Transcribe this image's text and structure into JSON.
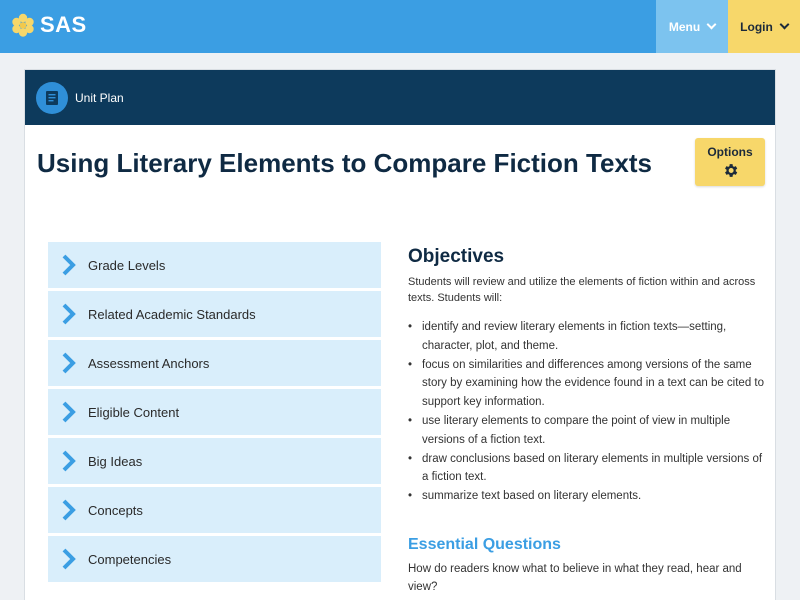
{
  "header": {
    "logo_text": "SAS",
    "menu_label": "Menu",
    "login_label": "Login",
    "colors": {
      "bar": "#3b9ee3",
      "menu": "#7cc3ef",
      "login": "#f7d76a"
    }
  },
  "unit": {
    "label": "Unit Plan",
    "icon": "document-icon"
  },
  "page": {
    "title": "Using Literary Elements to Compare Fiction Texts"
  },
  "options": {
    "label": "Options",
    "icon": "gear-icon"
  },
  "accordion": {
    "items": [
      {
        "label": "Grade Levels"
      },
      {
        "label": "Related Academic Standards"
      },
      {
        "label": "Assessment Anchors"
      },
      {
        "label": "Eligible Content"
      },
      {
        "label": "Big Ideas"
      },
      {
        "label": "Concepts"
      },
      {
        "label": "Competencies"
      }
    ]
  },
  "objectives": {
    "title": "Objectives",
    "intro": "Students will review and utilize the elements of fiction within and across texts. Students will:",
    "items": [
      "identify and review literary elements in fiction texts—setting, character, plot, and theme.",
      "focus on similarities and differences among versions of the same story by examining how the evidence found in a text can be cited to support key information.",
      "use literary elements to compare the point of view in multiple versions of a fiction text.",
      "draw conclusions based on literary elements in multiple versions of a fiction text.",
      "summarize text based on literary elements."
    ]
  },
  "essential_questions": {
    "title": "Essential Questions",
    "text": "How do readers know what to believe in what they read, hear and view?"
  }
}
